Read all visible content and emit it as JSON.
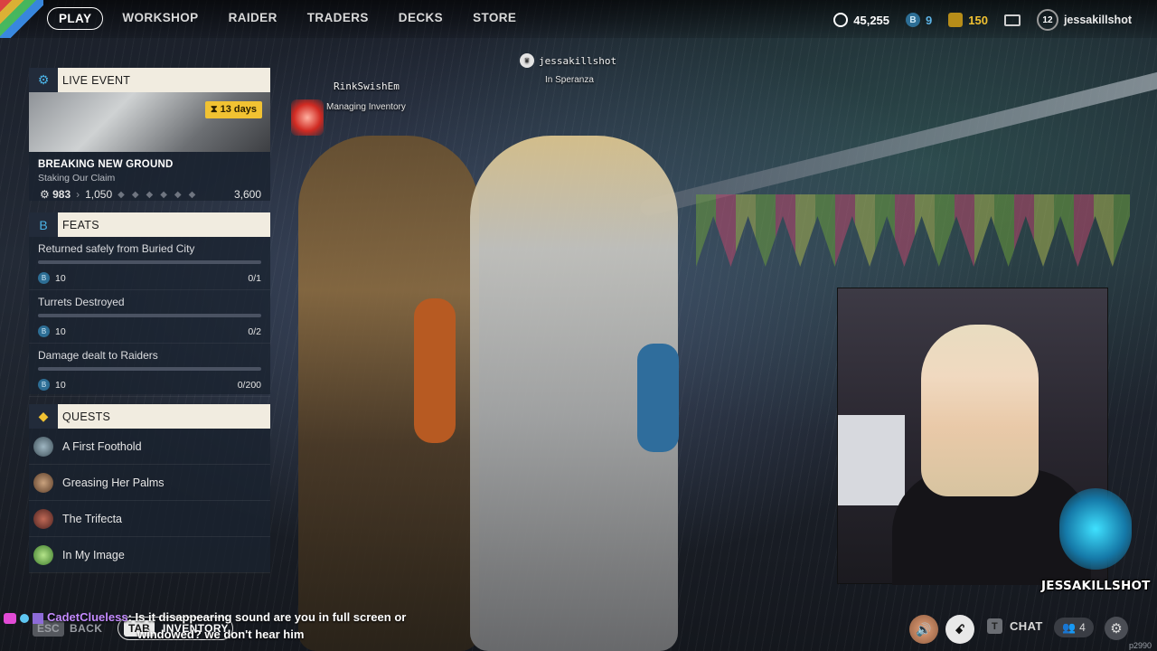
{
  "nav": {
    "items": [
      "PLAY",
      "WORKSHOP",
      "RAIDER",
      "TRADERS",
      "DECKS",
      "STORE"
    ],
    "active": "PLAY"
  },
  "currency": {
    "coins": "45,255",
    "tokens": "9",
    "stripes": "150"
  },
  "profile": {
    "level": "12",
    "username": "jessakillshot"
  },
  "live_event": {
    "header": "LIVE EVENT",
    "badge": "13 days",
    "title": "BREAKING NEW GROUND",
    "subtitle": "Staking Our Claim",
    "current": "983",
    "next": "1,050",
    "final": "3,600"
  },
  "feats": {
    "header": "FEATS",
    "items": [
      {
        "name": "Returned safely from Buried City",
        "reward": "10",
        "progress": "0/1"
      },
      {
        "name": "Turrets Destroyed",
        "reward": "10",
        "progress": "0/2"
      },
      {
        "name": "Damage dealt to Raiders",
        "reward": "10",
        "progress": "0/200"
      }
    ]
  },
  "quests": {
    "header": "QUESTS",
    "items": [
      "A First Foothold",
      "Greasing Her Palms",
      "The Trifecta",
      "In My Image"
    ]
  },
  "players": {
    "self": {
      "name": "jessakillshot",
      "status": "In Speranza"
    },
    "teammate": {
      "name": "RinkSwishEm",
      "status": "Managing Inventory"
    }
  },
  "chat_overlay": {
    "user": "CadetClueless",
    "line1": ": Is it disappearing sound are you in full screen or",
    "line2": "windowed? we don't hear him"
  },
  "bottom": {
    "esc_key": "ESC",
    "back_label": "BACK",
    "tab_key": "TAB",
    "inventory_label": "INVENTORY",
    "chat_key": "T",
    "chat_label": "CHAT",
    "party_count": "4",
    "build": "p2990"
  },
  "stream_logo": "JESSAKILLSHOT",
  "colors": {
    "accent_yellow": "#f1c232",
    "accent_blue": "#4bb3e6",
    "panel_header": "#f1ece0"
  }
}
